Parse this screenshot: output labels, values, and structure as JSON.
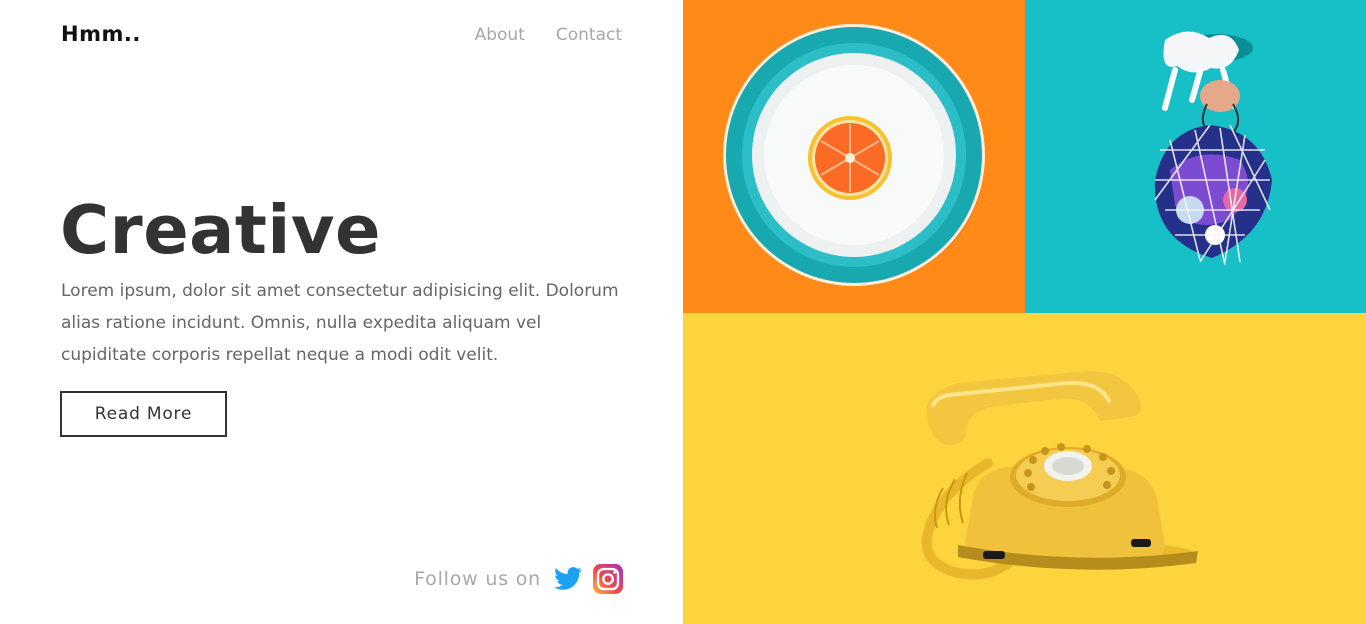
{
  "brand": {
    "logo": "Hmm.."
  },
  "nav": {
    "items": [
      "About",
      "Contact"
    ]
  },
  "hero": {
    "title": "Creative",
    "text": "Lorem ipsum, dolor sit amet consectetur adipisicing elit. Dolorum alias ratione incidunt. Omnis, nulla expedita aliquam vel cupiditate corporis repellat neque a modi odit velit.",
    "button_label": "Read More"
  },
  "social": {
    "label": "Follow us on",
    "icons": [
      "twitter-icon",
      "instagram-icon"
    ]
  },
  "colors": {
    "orange": "#ff8a17",
    "teal": "#17bfc7",
    "yellow": "#fed43e",
    "heading": "#333333",
    "muted": "#a8a8a8",
    "twitter": "#1da1f2"
  },
  "gallery": [
    "orange-plate-photo",
    "mesh-bag-photo",
    "yellow-telephone-photo"
  ]
}
